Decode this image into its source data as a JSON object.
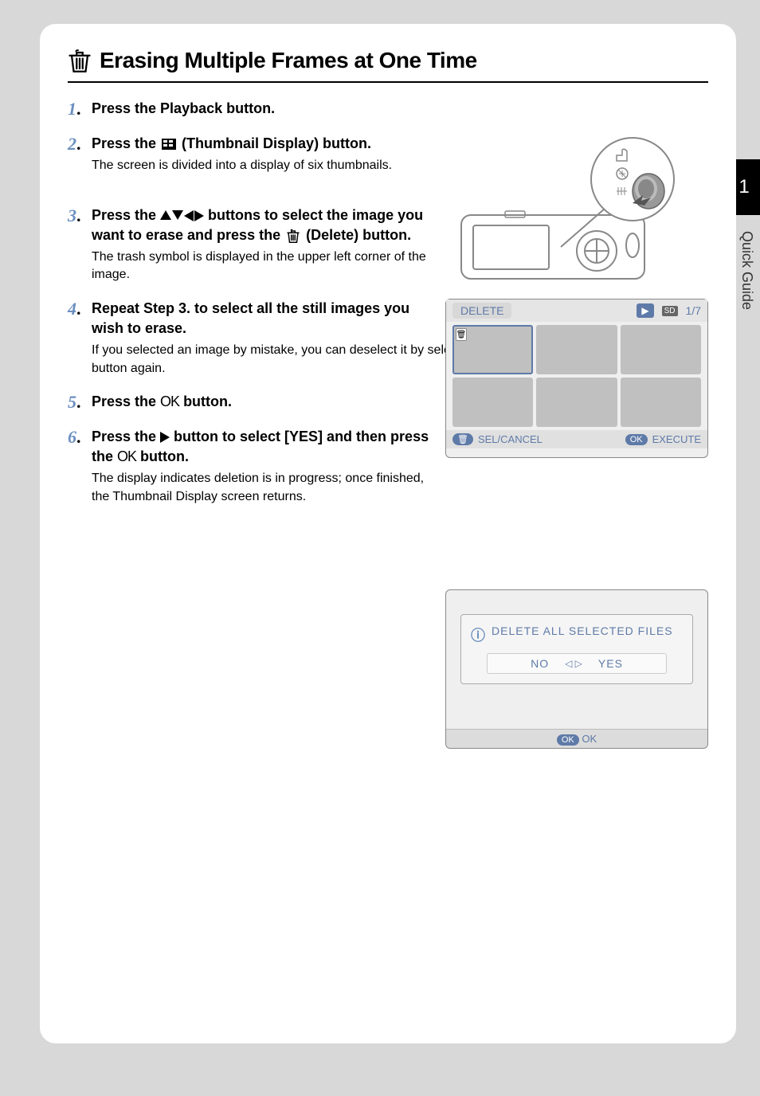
{
  "sidebar": {
    "chapter_number": "1",
    "chapter_label": "Quick Guide"
  },
  "section": {
    "title": "Erasing Multiple Frames at One Time"
  },
  "steps": [
    {
      "num": "1",
      "title": "Press the Playback button."
    },
    {
      "num": "2",
      "title_before": "Press the ",
      "title_after": " (Thumbnail Display) button.",
      "desc": "The screen is divided into a display of six thumbnails."
    },
    {
      "num": "3",
      "title_before": "Press the ",
      "title_mid": " buttons to select the image you want to erase and press the ",
      "title_after": " (Delete) button.",
      "desc": "The trash symbol is displayed in the upper left corner of the image."
    },
    {
      "num": "4",
      "title": "Repeat Step 3. to select all the still images you wish to erase.",
      "desc_before": "If you selected an image by mistake, you can deselect it by selecting the image and pressing the ",
      "desc_after": " (Delete) button again."
    },
    {
      "num": "5",
      "title_before": "Press the ",
      "title_after": " button."
    },
    {
      "num": "6",
      "title_before": "Press the ",
      "title_mid": " button to select [YES] and then press the ",
      "title_after": " button.",
      "desc": "The display indicates deletion is in progress; once finished, the Thumbnail Display screen returns."
    }
  ],
  "thumbnail_screen": {
    "header_label": "DELETE",
    "page_indicator": "1/7",
    "footer_sel": "SEL/CANCEL",
    "footer_exec": "EXECUTE"
  },
  "confirm_screen": {
    "message": "DELETE ALL SELECTED FILES",
    "no": "NO",
    "yes": "YES",
    "footer": "OK"
  },
  "icons": {
    "ok_label": "OK"
  }
}
